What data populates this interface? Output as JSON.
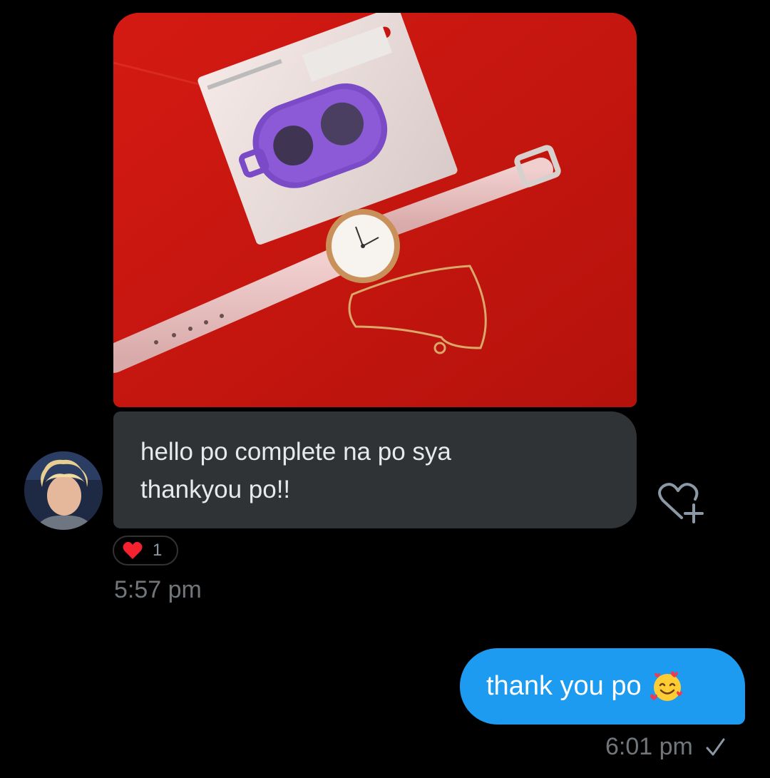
{
  "conversation": {
    "received": {
      "photo": {
        "description_icon": "photo-attachment"
      },
      "text_lines": [
        "hello po complete na po sya",
        "thankyou po!!"
      ],
      "reaction": {
        "emoji": "heart",
        "count": "1"
      },
      "timestamp": "5:57 pm"
    },
    "sent": {
      "text": "thank you po",
      "emoji": "smiling-face-with-hearts",
      "timestamp": "6:01 pm",
      "status_icon": "check-icon"
    }
  },
  "colors": {
    "background": "#000000",
    "received_bubble": "#2f3336",
    "sent_bubble": "#1d9bf0",
    "timestamp": "#71767b",
    "heart": "#f91880"
  }
}
